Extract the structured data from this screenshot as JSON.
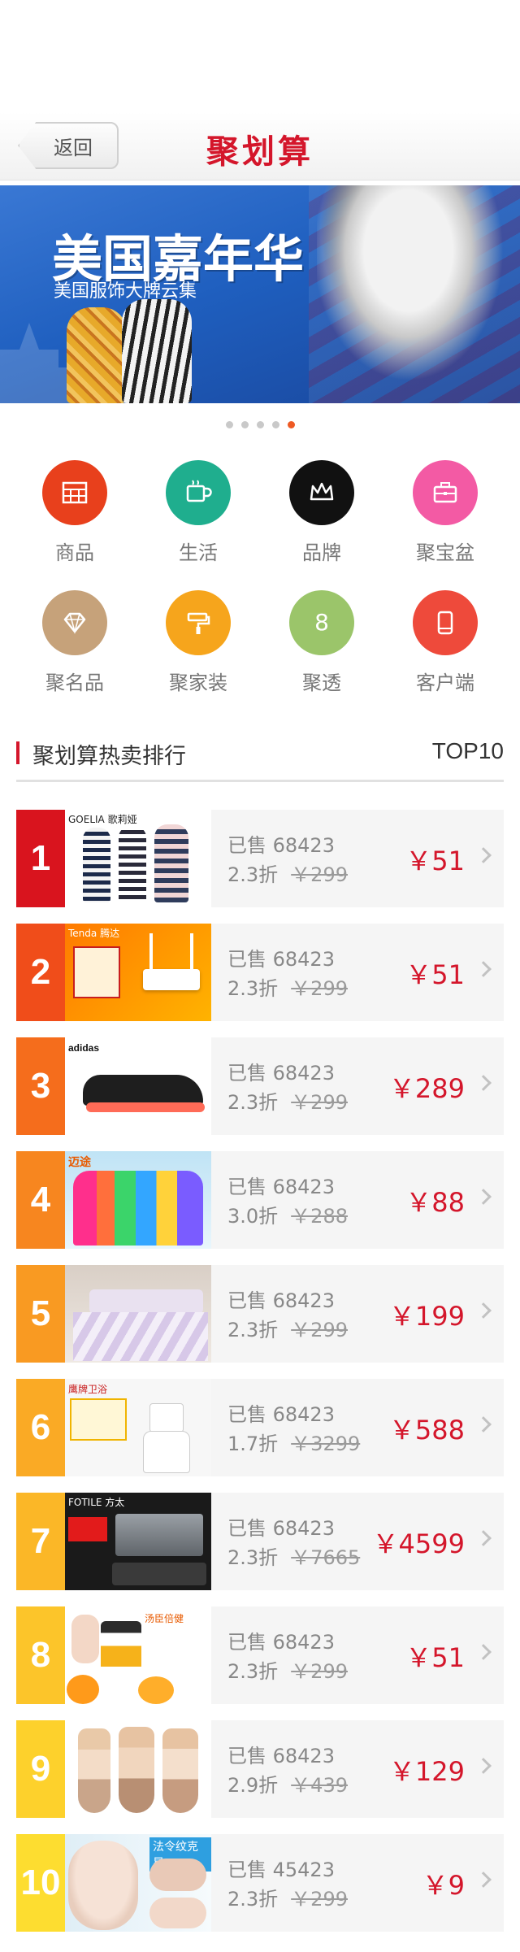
{
  "header": {
    "back_label": "返回",
    "title": "聚划算"
  },
  "banner": {
    "title": "美国嘉年华",
    "subtitle": "美国服饰大牌云集",
    "dots_count": 5,
    "active_dot": 4
  },
  "categories": [
    {
      "label": "商品",
      "color": "#e8401c",
      "icon": "calendar-icon"
    },
    {
      "label": "生活",
      "color": "#1fae8e",
      "icon": "cup-icon"
    },
    {
      "label": "品牌",
      "color": "#111111",
      "icon": "crown-icon"
    },
    {
      "label": "聚宝盆",
      "color": "#f35aa4",
      "icon": "briefcase-icon"
    },
    {
      "label": "聚名品",
      "color": "#c6a27a",
      "icon": "diamond-icon"
    },
    {
      "label": "聚家装",
      "color": "#f6a51c",
      "icon": "paint-roller-icon"
    },
    {
      "label": "聚透",
      "color": "#9bc56a",
      "icon": "eight-icon"
    },
    {
      "label": "客户端",
      "color": "#ee4a3b",
      "icon": "phone-icon"
    }
  ],
  "section": {
    "title": "聚划算热卖排行",
    "top_label": "TOP10"
  },
  "ranking": [
    {
      "rank": "1",
      "sold": "已售 68423",
      "discount": "2.3折",
      "orig": "￥299",
      "price": "￥51",
      "rank_color": "#d9141e",
      "thumb_brand": "GOELIA 歌莉娅"
    },
    {
      "rank": "2",
      "sold": "已售 68423",
      "discount": "2.3折",
      "orig": "￥299",
      "price": "￥51",
      "rank_color": "#f04d1a",
      "thumb_brand": "Tenda 腾达"
    },
    {
      "rank": "3",
      "sold": "已售 68423",
      "discount": "2.3折",
      "orig": "￥299",
      "price": "￥289",
      "rank_color": "#f56d1c",
      "thumb_brand": "adidas"
    },
    {
      "rank": "4",
      "sold": "已售 68423",
      "discount": "3.0折",
      "orig": "￥288",
      "price": "￥88",
      "rank_color": "#f7861f",
      "thumb_brand": "迈途"
    },
    {
      "rank": "5",
      "sold": "已售 68423",
      "discount": "2.3折",
      "orig": "￥299",
      "price": "￥199",
      "rank_color": "#f99a22",
      "thumb_brand": ""
    },
    {
      "rank": "6",
      "sold": "已售 68423",
      "discount": "1.7折",
      "orig": "￥3299",
      "price": "￥588",
      "rank_color": "#faaa25",
      "thumb_brand": "鹰牌卫浴"
    },
    {
      "rank": "7",
      "sold": "已售 68423",
      "discount": "2.3折",
      "orig": "￥7665",
      "price": "￥4599",
      "rank_color": "#fbb727",
      "thumb_brand": "FOTILE 方太"
    },
    {
      "rank": "8",
      "sold": "已售 68423",
      "discount": "2.3折",
      "orig": "￥299",
      "price": "￥51",
      "rank_color": "#fcc52a",
      "thumb_brand": "汤臣倍健"
    },
    {
      "rank": "9",
      "sold": "已售 68423",
      "discount": "2.9折",
      "orig": "￥439",
      "price": "￥129",
      "rank_color": "#fdd12c",
      "thumb_brand": ""
    },
    {
      "rank": "10",
      "sold": "已售 45423",
      "discount": "2.3折",
      "orig": "￥299",
      "price": "￥9",
      "rank_color": "#fddd30",
      "thumb_brand": "法令纹克星"
    }
  ]
}
